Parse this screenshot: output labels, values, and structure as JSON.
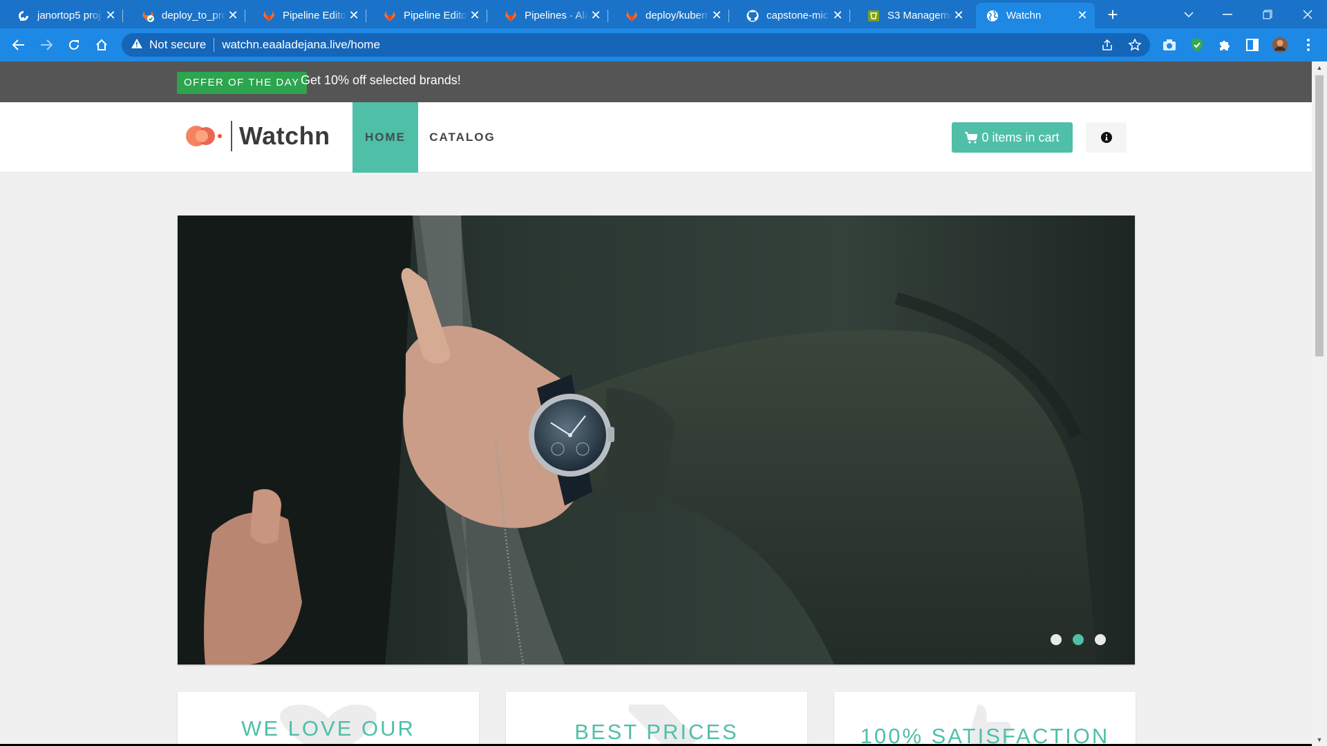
{
  "browser": {
    "tabs": [
      {
        "title": "janortop5 proj",
        "favicon": "digitalocean-icon"
      },
      {
        "title": "deploy_to_pro",
        "favicon": "gitlab-check-icon"
      },
      {
        "title": "Pipeline Editor",
        "favicon": "gitlab-icon"
      },
      {
        "title": "Pipeline Editor",
        "favicon": "gitlab-icon"
      },
      {
        "title": "Pipelines · Ala",
        "favicon": "gitlab-icon"
      },
      {
        "title": "deploy/kubern",
        "favicon": "gitlab-icon"
      },
      {
        "title": "capstone-mic",
        "favicon": "github-icon"
      },
      {
        "title": "S3 Manageme",
        "favicon": "aws-s3-icon"
      },
      {
        "title": "Watchn",
        "favicon": "globe-icon",
        "active": true
      }
    ],
    "security_label": "Not secure",
    "url": "watchn.eaaladejana.live/home"
  },
  "promo": {
    "badge": "OFFER OF THE DAY",
    "text": "Get 10% off selected brands!"
  },
  "nav": {
    "logo_text": "Watchn",
    "home": "HOME",
    "catalog": "CATALOG",
    "cart": "0 items in cart"
  },
  "carousel": {
    "slides": 3,
    "active_slide": 2
  },
  "cards": [
    {
      "title": "WE LOVE OUR"
    },
    {
      "title": "BEST PRICES"
    },
    {
      "title": "100% SATISFACTION"
    }
  ],
  "colors": {
    "accent": "#4fbfa8",
    "promo_bg": "#555555",
    "promo_badge": "#2da44e",
    "browser_blue": "#1e88e5"
  }
}
